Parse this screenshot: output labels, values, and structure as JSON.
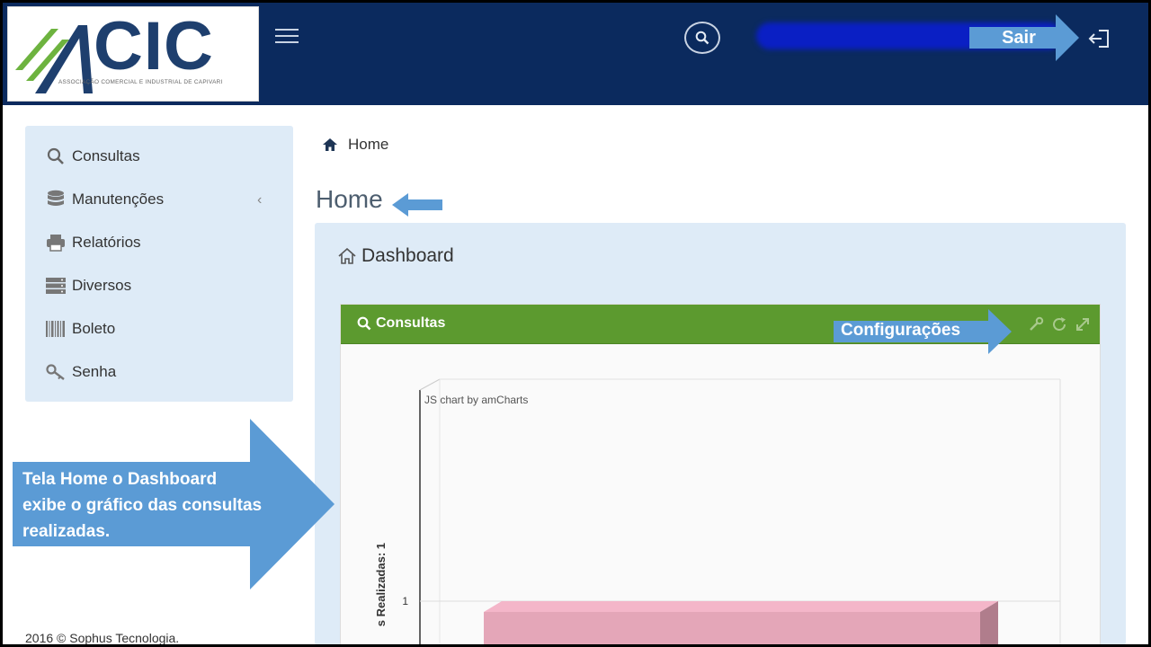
{
  "header": {
    "logo_text": "CIC",
    "logo_subtitle": "ASSOCIAÇÃO COMERCIAL E INDUSTRIAL DE CAPIVARI",
    "logout_annotation": "Sair"
  },
  "sidebar": {
    "items": [
      {
        "label": "Consultas",
        "icon": "search-icon"
      },
      {
        "label": "Manutenções",
        "icon": "database-icon"
      },
      {
        "label": "Relatórios",
        "icon": "printer-icon"
      },
      {
        "label": "Diversos",
        "icon": "server-icon"
      },
      {
        "label": "Boleto",
        "icon": "barcode-icon"
      },
      {
        "label": "Senha",
        "icon": "key-icon"
      }
    ]
  },
  "breadcrumb": {
    "home": "Home"
  },
  "page": {
    "title": "Home"
  },
  "panel": {
    "title": "Dashboard"
  },
  "widget": {
    "title": "Consultas",
    "config_annotation": "Configurações"
  },
  "chart_data": {
    "type": "bar",
    "credit": "JS chart by amCharts",
    "ylabel": "s Realizadas: 1",
    "y_tick": "1",
    "values": [
      1
    ],
    "bar_color": "#e4a6b8"
  },
  "annotation": {
    "line1": "Tela Home o Dashboard",
    "line2": "exibe o gráfico das consultas",
    "line3": "realizadas."
  },
  "footer": {
    "text": "2016 © Sophus Tecnologia."
  },
  "colors": {
    "header_bg": "#0b2a5e",
    "accent_green": "#5c9a2f",
    "annotation_blue": "#5b9bd5"
  }
}
